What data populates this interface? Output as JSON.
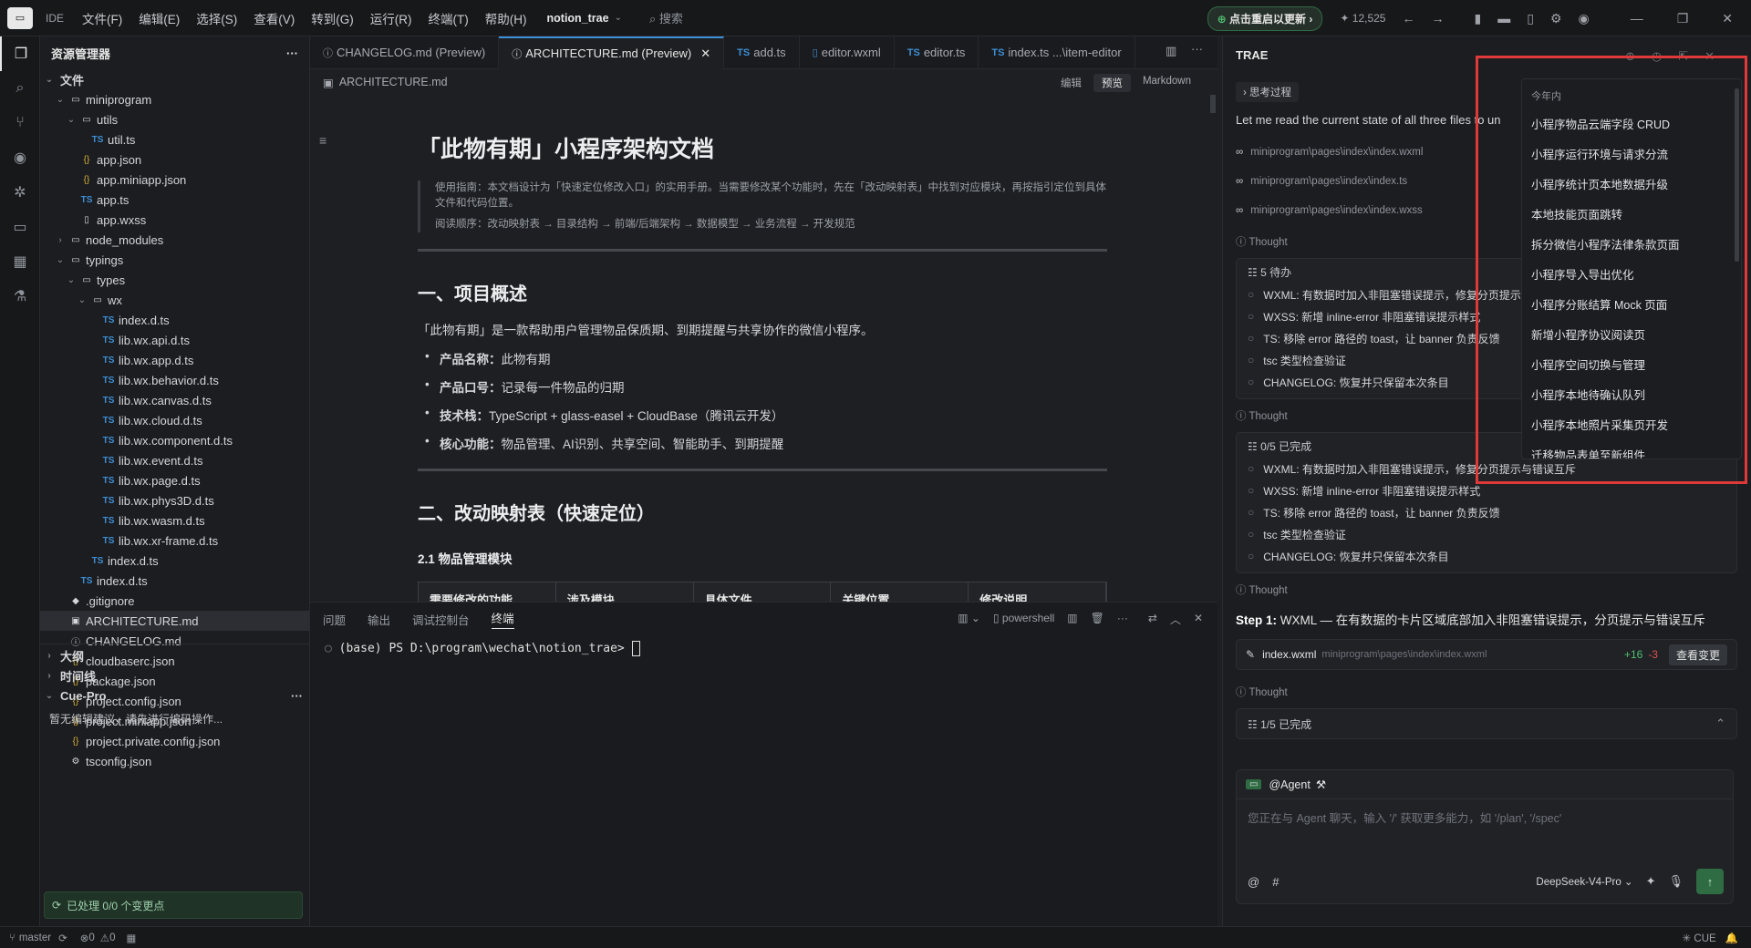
{
  "titlebar": {
    "ide": "IDE",
    "menus": [
      "文件(F)",
      "编辑(E)",
      "选择(S)",
      "查看(V)",
      "转到(G)",
      "运行(R)",
      "终端(T)",
      "帮助(H)"
    ],
    "project": "notion_trae",
    "search": "搜索",
    "update": "点击重启以更新",
    "count": "12,525"
  },
  "explorer": {
    "title": "资源管理器",
    "section": "文件",
    "rows": [
      {
        "indent": 0,
        "tw": "⌄",
        "icon": "",
        "label": "miniprogram",
        "kind": "folder"
      },
      {
        "indent": 1,
        "tw": "⌄",
        "icon": "",
        "label": "utils",
        "kind": "folder"
      },
      {
        "indent": 2,
        "tw": "",
        "icon": "TS",
        "label": "util.ts",
        "kind": "ts"
      },
      {
        "indent": 1,
        "tw": "",
        "icon": "{}",
        "label": "app.json",
        "kind": "json"
      },
      {
        "indent": 1,
        "tw": "",
        "icon": "{}",
        "label": "app.miniapp.json",
        "kind": "json"
      },
      {
        "indent": 1,
        "tw": "",
        "icon": "TS",
        "label": "app.ts",
        "kind": "ts"
      },
      {
        "indent": 1,
        "tw": "",
        "icon": "▯",
        "label": "app.wxss",
        "kind": "file"
      },
      {
        "indent": 0,
        "tw": "›",
        "icon": "",
        "label": "node_modules",
        "kind": "folder"
      },
      {
        "indent": 0,
        "tw": "⌄",
        "icon": "",
        "label": "typings",
        "kind": "folder"
      },
      {
        "indent": 1,
        "tw": "⌄",
        "icon": "",
        "label": "types",
        "kind": "folder"
      },
      {
        "indent": 2,
        "tw": "⌄",
        "icon": "",
        "label": "wx",
        "kind": "folder"
      },
      {
        "indent": 3,
        "tw": "",
        "icon": "TS",
        "label": "index.d.ts",
        "kind": "ts"
      },
      {
        "indent": 3,
        "tw": "",
        "icon": "TS",
        "label": "lib.wx.api.d.ts",
        "kind": "ts"
      },
      {
        "indent": 3,
        "tw": "",
        "icon": "TS",
        "label": "lib.wx.app.d.ts",
        "kind": "ts"
      },
      {
        "indent": 3,
        "tw": "",
        "icon": "TS",
        "label": "lib.wx.behavior.d.ts",
        "kind": "ts"
      },
      {
        "indent": 3,
        "tw": "",
        "icon": "TS",
        "label": "lib.wx.canvas.d.ts",
        "kind": "ts"
      },
      {
        "indent": 3,
        "tw": "",
        "icon": "TS",
        "label": "lib.wx.cloud.d.ts",
        "kind": "ts"
      },
      {
        "indent": 3,
        "tw": "",
        "icon": "TS",
        "label": "lib.wx.component.d.ts",
        "kind": "ts"
      },
      {
        "indent": 3,
        "tw": "",
        "icon": "TS",
        "label": "lib.wx.event.d.ts",
        "kind": "ts"
      },
      {
        "indent": 3,
        "tw": "",
        "icon": "TS",
        "label": "lib.wx.page.d.ts",
        "kind": "ts"
      },
      {
        "indent": 3,
        "tw": "",
        "icon": "TS",
        "label": "lib.wx.phys3D.d.ts",
        "kind": "ts"
      },
      {
        "indent": 3,
        "tw": "",
        "icon": "TS",
        "label": "lib.wx.wasm.d.ts",
        "kind": "ts"
      },
      {
        "indent": 3,
        "tw": "",
        "icon": "TS",
        "label": "lib.wx.xr-frame.d.ts",
        "kind": "ts"
      },
      {
        "indent": 2,
        "tw": "",
        "icon": "TS",
        "label": "index.d.ts",
        "kind": "ts"
      },
      {
        "indent": 1,
        "tw": "",
        "icon": "TS",
        "label": "index.d.ts",
        "kind": "ts"
      },
      {
        "indent": 0,
        "tw": "",
        "icon": "◆",
        "label": ".gitignore",
        "kind": "file"
      },
      {
        "indent": 0,
        "tw": "",
        "icon": "▣",
        "label": "ARCHITECTURE.md",
        "kind": "md"
      },
      {
        "indent": 0,
        "tw": "",
        "icon": "ⓘ",
        "label": "CHANGELOG.md",
        "kind": "md"
      },
      {
        "indent": 0,
        "tw": "",
        "icon": "{}",
        "label": "cloudbaserc.json",
        "kind": "json"
      },
      {
        "indent": 0,
        "tw": "",
        "icon": "{}",
        "label": "package.json",
        "kind": "json"
      },
      {
        "indent": 0,
        "tw": "",
        "icon": "{}",
        "label": "project.config.json",
        "kind": "json"
      },
      {
        "indent": 0,
        "tw": "",
        "icon": "{}",
        "label": "project.miniapp.json",
        "kind": "json"
      },
      {
        "indent": 0,
        "tw": "",
        "icon": "{}",
        "label": "project.private.config.json",
        "kind": "json"
      },
      {
        "indent": 0,
        "tw": "",
        "icon": "⚙",
        "label": "tsconfig.json",
        "kind": "file"
      }
    ],
    "outline": "大纲",
    "timeline": "时间线",
    "cue": "Cue-Pro",
    "cue_msg": "暂无编辑建议，请先进行编码操作...",
    "cue_status": "已处理 0/0 个变更点"
  },
  "tabs": [
    "CHANGELOG.md (Preview)",
    "ARCHITECTURE.md (Preview)",
    "add.ts",
    "editor.wxml",
    "editor.ts",
    "index.ts ...\\item-editor"
  ],
  "breadcrumb": "ARCHITECTURE.md",
  "modes": [
    "编辑",
    "预览",
    "Markdown"
  ],
  "doc": {
    "title": "「此物有期」小程序架构文档",
    "quote1": "使用指南：本文档设计为「快速定位修改入口」的实用手册。当需要修改某个功能时，先在「改动映射表」中找到对应模块，再按指引定位到具体文件和代码位置。",
    "quote2": "阅读顺序：改动映射表 → 目录结构 → 前端/后端架构 → 数据模型 → 业务流程 → 开发规范",
    "h2a": "一、项目概述",
    "intro": "「此物有期」是一款帮助用户管理物品保质期、到期提醒与共享协作的微信小程序。",
    "bullets": [
      [
        "产品名称：",
        "此物有期"
      ],
      [
        "产品口号：",
        "记录每一件物品的归期"
      ],
      [
        "技术栈：",
        "TypeScript + glass-easel + CloudBase（腾讯云开发）"
      ],
      [
        "核心功能：",
        "物品管理、AI识别、共享空间、智能助手、到期提醒"
      ]
    ],
    "h2b": "二、改动映射表（快速定位）",
    "h3": "2.1 物品管理模块",
    "cols": [
      "需要修改的功能",
      "涉及模块",
      "具体文件",
      "关键位置",
      "修改说明"
    ]
  },
  "panel": {
    "tabs": [
      "问题",
      "输出",
      "调试控制台",
      "终端"
    ],
    "shell": "powershell",
    "prompt": "(base) PS D:\\program\\wechat\\notion_trae> "
  },
  "assistant": {
    "title": "TRAE",
    "thinking": "思考过程",
    "intro": "Let me read the current state of all three files to un",
    "paths": [
      "miniprogram\\pages\\index\\index.wxml",
      "miniprogram\\pages\\index\\index.ts",
      "miniprogram\\pages\\index\\index.wxss"
    ],
    "thought": "Thought",
    "todo1_head": "5 待办",
    "todo2_head": "0/5 已完成",
    "todos": [
      "WXML: 有数据时加入非阻塞错误提示，修复分页提示与错误互斥",
      "WXSS: 新增 inline-error 非阻塞错误提示样式",
      "TS: 移除 error 路径的 toast，让 banner 负责反馈",
      "tsc 类型检查验证",
      "CHANGELOG: 恢复并只保留本次条目"
    ],
    "step_b": "Step 1:",
    "step_t": " WXML — 在有数据的卡片区域底部加入非阻塞错误提示，分页提示与错误互斥",
    "file_name": "index.wxml",
    "file_path": "miniprogram\\pages\\index\\index.wxml",
    "add": "+16",
    "del": "-3",
    "view": "查看变更",
    "todo3_head": "1/5 已完成",
    "agent": "@Agent",
    "placeholder": "您正在与 Agent 聊天，输入 '/' 获取更多能力，如 '/plan', '/spec'",
    "model": "DeepSeek-V4-Pro"
  },
  "history": {
    "section": "今年内",
    "items": [
      "小程序物品云端字段 CRUD",
      "小程序运行环境与请求分流",
      "小程序统计页本地数据升级",
      "本地技能页面跳转",
      "拆分微信小程序法律条款页面",
      "小程序导入导出优化",
      "小程序分账结算 Mock 页面",
      "新增小程序协议阅读页",
      "小程序空间切换与管理",
      "小程序本地待确认队列",
      "小程序本地照片采集页开发",
      "迁移物品表单至新组件"
    ]
  },
  "status": {
    "branch": "master",
    "errors": "0",
    "warnings": "0",
    "cue": "CUE"
  }
}
